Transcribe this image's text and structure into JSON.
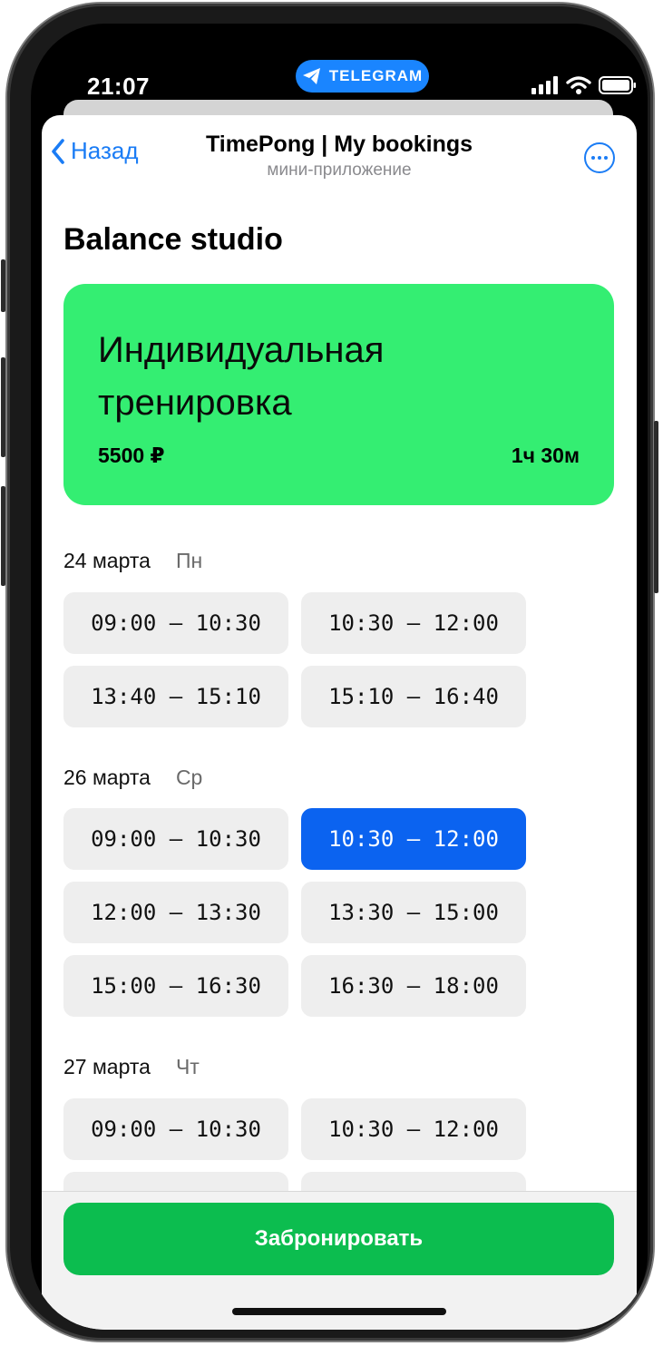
{
  "status_bar": {
    "time": "21:07",
    "pill_label": "TELEGRAM",
    "pill_icon": "telegram-plane-icon"
  },
  "nav": {
    "back_label": "Назад",
    "title": "TimePong | My bookings",
    "subtitle": "мини-приложение",
    "more_icon": "ellipsis-circle-icon"
  },
  "studio": {
    "name": "Balance studio"
  },
  "service": {
    "name": "Индивидуальная тренировка",
    "price": "5500 ₽",
    "duration": "1ч 30м",
    "color": "#34ee72"
  },
  "days": [
    {
      "date": "24 марта",
      "weekday": "Пн",
      "slots": [
        {
          "label": "09:00 – 10:30"
        },
        {
          "label": "10:30 – 12:00"
        },
        {
          "label": "13:40 – 15:10"
        },
        {
          "label": "15:10 – 16:40"
        }
      ]
    },
    {
      "date": "26 марта",
      "weekday": "Ср",
      "slots": [
        {
          "label": "09:00 – 10:30"
        },
        {
          "label": "10:30 – 12:00",
          "selected": true
        },
        {
          "label": "12:00 – 13:30"
        },
        {
          "label": "13:30 – 15:00"
        },
        {
          "label": "15:00 – 16:30"
        },
        {
          "label": "16:30 – 18:00"
        }
      ]
    },
    {
      "date": "27 марта",
      "weekday": "Чт",
      "slots": [
        {
          "label": "09:00 – 10:30"
        },
        {
          "label": "10:30 – 12:00"
        },
        {
          "label": ""
        },
        {
          "label": ""
        }
      ]
    }
  ],
  "actions": {
    "book_label": "Забронировать"
  },
  "colors": {
    "accent": "#1a7cf5",
    "selected_slot": "#0b63f0",
    "book_button": "#0cbd4f"
  }
}
